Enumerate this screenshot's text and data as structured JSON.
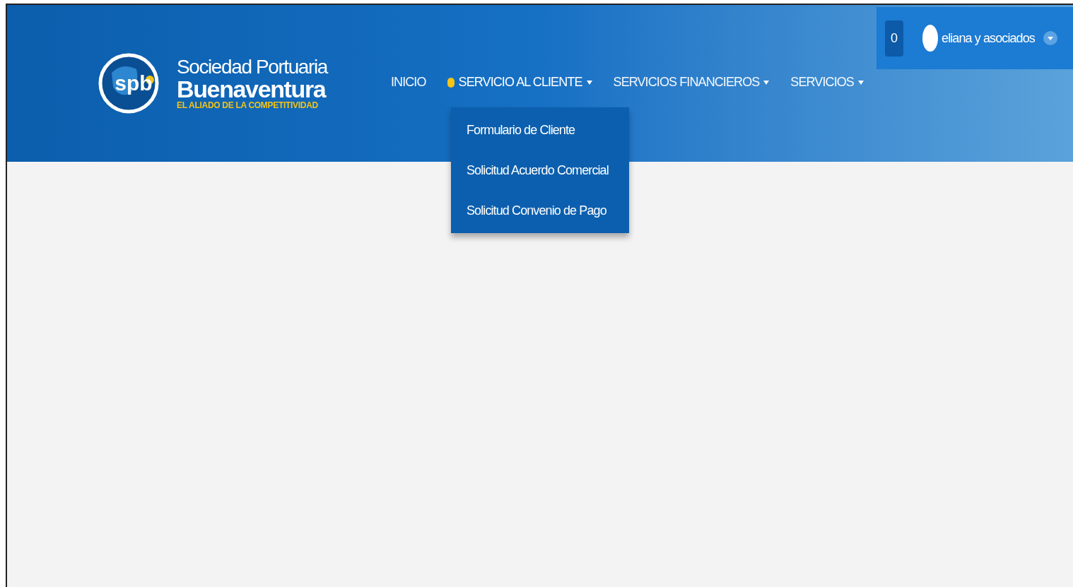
{
  "logo": {
    "mark": "spb",
    "line1": "Sociedad Portuaria",
    "line2": "Buenaventura",
    "tagline": "EL ALIADO DE LA COMPETITIVIDAD"
  },
  "nav": [
    {
      "label": "INICIO",
      "selected": false,
      "caret": false
    },
    {
      "label": "SERVICIO AL CLIENTE",
      "selected": true,
      "caret": true
    },
    {
      "label": "SERVICIOS FINANCIEROS",
      "selected": false,
      "caret": true
    },
    {
      "label": "SERVICIOS",
      "selected": false,
      "caret": true
    }
  ],
  "dropdown": [
    "Formulario de Cliente",
    "Solicitud Acuerdo Comercial",
    "Solicitud Convenio de Pago"
  ],
  "user": {
    "notifications": "0",
    "name": "eliana y asociados"
  }
}
